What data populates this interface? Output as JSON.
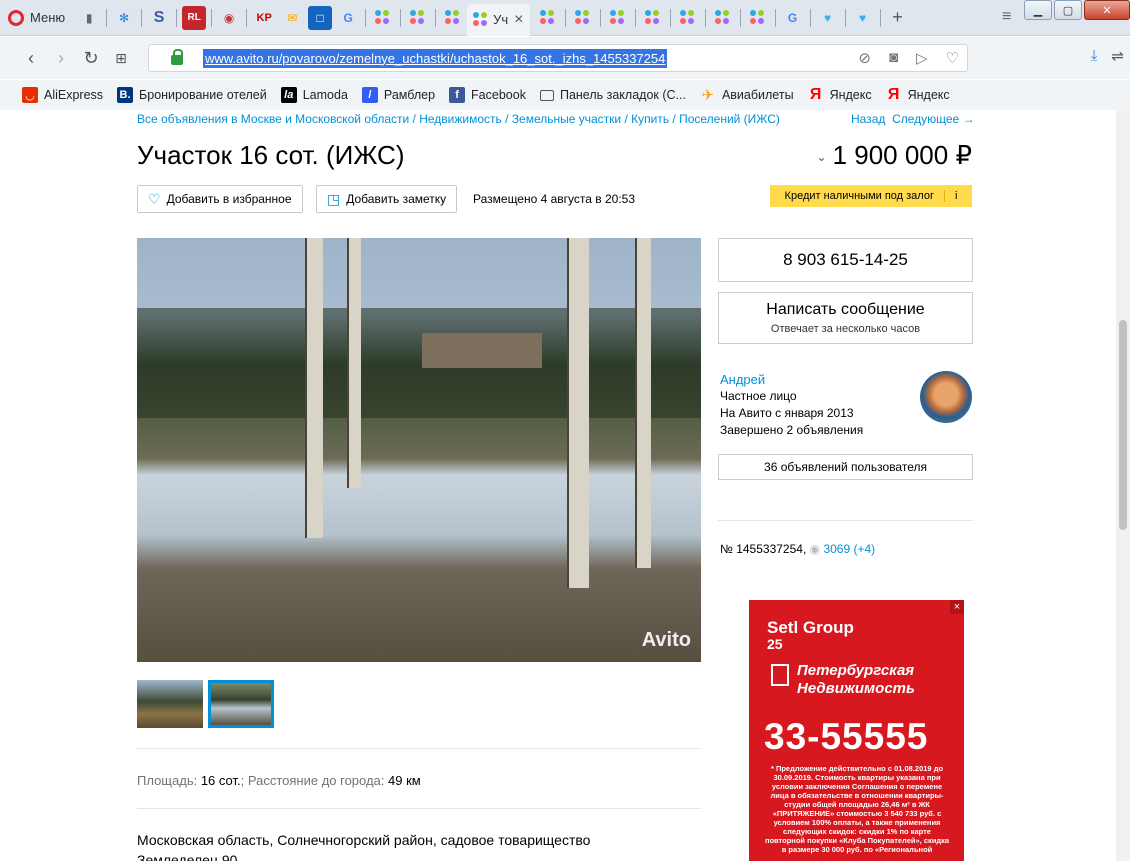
{
  "browser": {
    "menu_label": "Меню",
    "active_tab_label": "Уч",
    "url": "www.avito.ru/povarovo/zemelnye_uchastki/uchastok_16_sot._izhs_1455337254",
    "bookmarks": [
      {
        "label": "AliExpress",
        "icon": "aliexpress-icon",
        "color": "#e62e04"
      },
      {
        "label": "Бронирование отелей",
        "icon": "booking-icon",
        "color": "#003580"
      },
      {
        "label": "Lamoda",
        "icon": "lamoda-icon",
        "color": "#000000"
      },
      {
        "label": "Рамблер",
        "icon": "rambler-icon",
        "color": "#315efb"
      },
      {
        "label": "Facebook",
        "icon": "facebook-icon",
        "color": "#3b5998"
      },
      {
        "label": "Панель закладок (С...",
        "icon": "folder-icon",
        "color": "#555555"
      },
      {
        "label": "Авиабилеты",
        "icon": "plane-icon",
        "color": "#f5a623"
      },
      {
        "label": "Яндекс",
        "icon": "yandex-icon",
        "color": "#ff0000"
      },
      {
        "label": "Яндекс",
        "icon": "yandex-icon",
        "color": "#ff0000"
      }
    ]
  },
  "listing": {
    "breadcrumb": "Все объявления в Москве и Московской области / Недвижимость / Земельные участки / Купить / Поселений (ИЖС)",
    "nav_back": "Назад",
    "nav_next": "Следующее →",
    "title": "Участок 16 сот. (ИЖС)",
    "price": "1 900 000 ₽",
    "add_favorite": "Добавить в избранное",
    "add_note": "Добавить заметку",
    "posted": "Размещено 4 августа в 20:53",
    "credit_label": "Кредит наличными под залог",
    "photo_watermark": "Avito",
    "params_label_area": "Площадь:",
    "params_value_area": "16 сот.",
    "params_label_distance": "Расстояние до города:",
    "params_value_distance": "49 км",
    "address_line1": "Московская область, Солнечногорский район, садовое товарищество",
    "address_line2": "Земледелец 90"
  },
  "contact": {
    "phone": "8 903 615-14-25",
    "message_button": "Написать сообщение",
    "message_sub": "Отвечает за несколько часов",
    "seller_name": "Андрей",
    "seller_type": "Частное лицо",
    "seller_since": "На Авито с января 2013",
    "seller_completed": "Завершено 2 объявления",
    "user_ads": "36 объявлений пользователя",
    "ad_number": "№ 1455337254,",
    "views": "3069 (+4)"
  },
  "banner": {
    "brand": "Setl Group",
    "brand_sub": "25",
    "company_line1": "Петербургская",
    "company_line2": "Недвижимость",
    "phone": "33-55555",
    "fine_print": "* Предложение действительно с 01.08.2019 до 30.09.2019. Стоимость квартиры указана при условии заключения Соглашения о перемене лица в обязательстве в отношении квартиры-студии общей площадью 26,46 м² в ЖК «ПРИТЯЖЕНИЕ» стоимостью 3 540 733 руб. с условием 100% оплаты, а также применения следующих скидок: скидки 1% по карте повторной покупки «Клуба Покупателей», скидка в размере 30 000 руб. по «Региональной"
  }
}
